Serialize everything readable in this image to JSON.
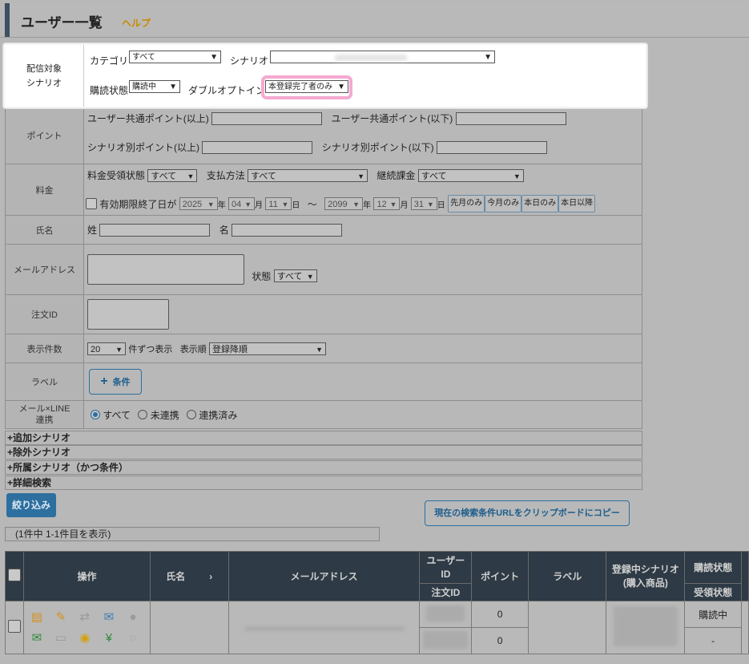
{
  "header": {
    "title": "ユーザー一覧",
    "help": "ヘルプ"
  },
  "scenario": {
    "label_line1": "配信対象",
    "label_line2": "シナリオ",
    "category_label": "カテゴリ",
    "category_value": "すべて",
    "scenario_label": "シナリオ",
    "scenario_value": "",
    "status_label": "購読状態",
    "status_value": "購読中",
    "double_optin_label": "ダブルオプトイン",
    "double_optin_value": "本登録完了者のみ"
  },
  "points": {
    "label": "ポイント",
    "common_min": "ユーザー共通ポイント(以上)",
    "common_max": "ユーザー共通ポイント(以下)",
    "scenario_min": "シナリオ別ポイント(以上)",
    "scenario_max": "シナリオ別ポイント(以下)"
  },
  "fee": {
    "label": "料金",
    "receive_label": "料金受領状態",
    "receive_value": "すべて",
    "pay_label": "支払方法",
    "pay_value": "すべて",
    "recurring_label": "継続課金",
    "recurring_value": "すべて",
    "expiry_label": "有効期限終了日が",
    "from_year": "2025",
    "from_month": "04",
    "from_day": "11",
    "to_year": "2099",
    "to_month": "12",
    "to_day": "31",
    "year": "年",
    "month": "月",
    "day": "日",
    "tilde": "～",
    "btn_last_month": "先月のみ",
    "btn_this_month": "今月のみ",
    "btn_today": "本日のみ",
    "btn_after_today": "本日以降"
  },
  "name": {
    "label": "氏名",
    "last": "姓",
    "first": "名"
  },
  "email": {
    "label": "メールアドレス",
    "status_label": "状態",
    "status_value": "すべて"
  },
  "order": {
    "label": "注文ID"
  },
  "display": {
    "label": "表示件数",
    "count_value": "20",
    "per": "件ずつ表示",
    "order_label": "表示順",
    "order_value": "登録降順"
  },
  "labelrow": {
    "label": "ラベル",
    "button": "条件"
  },
  "line": {
    "label_line1": "メール×LINE",
    "label_line2": "連携",
    "opt_all": "すべて",
    "opt_unlinked": "未連携",
    "opt_linked": "連携済み"
  },
  "collapsibles": [
    "+追加シナリオ",
    "+除外シナリオ",
    "+所属シナリオ（かつ条件）",
    "+詳細検索"
  ],
  "buttons": {
    "filter": "絞り込み",
    "copy_url": "現在の検索条件URLをクリップボードにコピー"
  },
  "count_text": "(1件中 1-1件目を表示)",
  "table": {
    "headers": {
      "ops": "操作",
      "name": "氏名",
      "name_arrow": "›",
      "email": "メールアドレス",
      "user_id": "ユーザー\nID",
      "order_id": "注文ID",
      "point": "ポイント",
      "label": "ラベル",
      "scenario": "登録中シナリオ\n(購入商品)",
      "sub_status": "購読状態",
      "recv_status": "受領状態"
    },
    "row": {
      "point1": "0",
      "point2": "0",
      "sub_status": "購読中",
      "recv_status": "-"
    }
  }
}
